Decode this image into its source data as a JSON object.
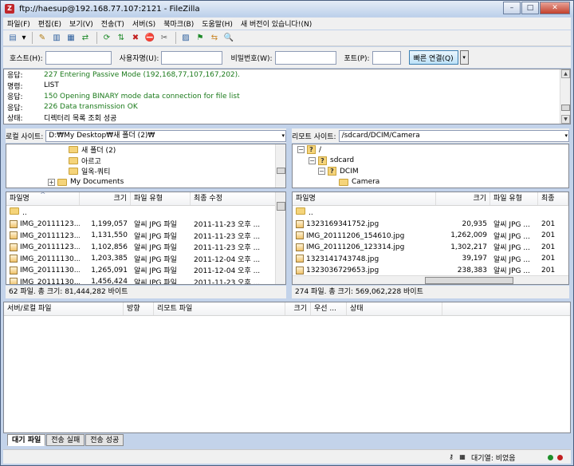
{
  "window": {
    "title": "ftp://haesup@192.168.77.107:2121 - FileZilla",
    "app_icon": "Z",
    "minimize": "–",
    "maximize": "□",
    "close": "✕"
  },
  "menu": [
    "파일(F)",
    "편집(E)",
    "보기(V)",
    "전송(T)",
    "서버(S)",
    "북마크(B)",
    "도움말(H)",
    "새 버전이 있습니다!(N)"
  ],
  "toolbar": {
    "icons": [
      "site-manager-icon",
      "toggle-log-icon",
      "toggle-local-tree-icon",
      "toggle-remote-tree-icon",
      "toggle-queue-icon",
      "refresh-icon",
      "process-queue-icon",
      "cancel-icon",
      "disconnect-icon",
      "reconnect-icon",
      "filter-icon",
      "compare-icon",
      "sync-browse-icon",
      "search-icon"
    ],
    "glyphs": [
      "▤",
      "▾",
      "✎",
      "▥",
      "▦",
      "⇄",
      "⟳",
      "⇅",
      "✖",
      "⛔",
      "✂",
      "▨",
      "⚑",
      "⇆",
      "🔍"
    ]
  },
  "quickconnect": {
    "host_label": "호스트(H):",
    "host_value": "",
    "user_label": "사용자명(U):",
    "user_value": "",
    "pass_label": "비밀번호(W):",
    "pass_value": "",
    "port_label": "포트(P):",
    "port_value": "",
    "button": "빠른 연결(Q)",
    "dropdown": "▾"
  },
  "log": [
    {
      "kind": "응답:",
      "msg": "227 Entering Passive Mode (192,168,77,107,167,202).",
      "green": true
    },
    {
      "kind": "명령:",
      "msg": "LIST",
      "green": false
    },
    {
      "kind": "응답:",
      "msg": "150 Opening BINARY mode data connection for file list",
      "green": true
    },
    {
      "kind": "응답:",
      "msg": "226 Data transmission OK",
      "green": true
    },
    {
      "kind": "상태:",
      "msg": "디렉터리 목록 조회 성공",
      "green": false
    }
  ],
  "scroll": {
    "up": "▲",
    "down": "▼",
    "left": "◀",
    "right": "▶"
  },
  "local": {
    "site_label": "로컬 사이트:",
    "path": "D:₩My Desktop₩새 폴더 (2)₩",
    "path_dropdown": "▾",
    "tree": [
      {
        "name": "새 폴더 (2)",
        "indent": 78,
        "expander": ""
      },
      {
        "name": "아르고",
        "indent": 78,
        "expander": ""
      },
      {
        "name": "일옥-쿼티",
        "indent": 78,
        "expander": ""
      },
      {
        "name": "My Documents",
        "indent": 52,
        "expander": "+"
      }
    ],
    "headers": [
      "파일명",
      "크기",
      "파일 유형",
      "최종 수정"
    ],
    "sort_glyph": "^",
    "files": [
      {
        "name": "..",
        "size": "",
        "type": "",
        "modified": ""
      },
      {
        "name": "IMG_20111123...",
        "size": "1,199,057",
        "type": "알씨 JPG 파일",
        "modified": "2011-11-23 오후 ..."
      },
      {
        "name": "IMG_20111123...",
        "size": "1,131,550",
        "type": "알씨 JPG 파일",
        "modified": "2011-11-23 오후 ..."
      },
      {
        "name": "IMG_20111123...",
        "size": "1,102,856",
        "type": "알씨 JPG 파일",
        "modified": "2011-11-23 오후 ..."
      },
      {
        "name": "IMG_20111130...",
        "size": "1,203,385",
        "type": "알씨 JPG 파일",
        "modified": "2011-12-04 오후 ..."
      },
      {
        "name": "IMG_20111130...",
        "size": "1,265,091",
        "type": "알씨 JPG 파일",
        "modified": "2011-12-04 오후 ..."
      },
      {
        "name": "IMG_20111130...",
        "size": "1,456,424",
        "type": "알씨 JPG 파일",
        "modified": "2011-11-23 오후 ..."
      }
    ],
    "status": "62 파일. 총 크기: 81,444,282 바이트"
  },
  "remote": {
    "site_label": "리모트 사이트:",
    "path": "/sdcard/DCIM/Camera",
    "path_dropdown": "▾",
    "tree": [
      {
        "name": "/",
        "indent": 6,
        "expander": "−",
        "icon": "q"
      },
      {
        "name": "sdcard",
        "indent": 20,
        "expander": "−",
        "icon": "q"
      },
      {
        "name": "DCIM",
        "indent": 32,
        "expander": "−",
        "icon": "q"
      },
      {
        "name": "Camera",
        "indent": 58,
        "expander": "",
        "icon": "folder"
      }
    ],
    "headers": [
      "파일명",
      "크기",
      "파일 유형",
      "최종"
    ],
    "files": [
      {
        "name": "..",
        "size": "",
        "type": "",
        "modified": ""
      },
      {
        "name": "1323169341752.jpg",
        "size": "20,935",
        "type": "알씨 JPG ...",
        "modified": "201"
      },
      {
        "name": "IMG_20111206_154610.jpg",
        "size": "1,262,009",
        "type": "알씨 JPG ...",
        "modified": "201"
      },
      {
        "name": "IMG_20111206_123314.jpg",
        "size": "1,302,217",
        "type": "알씨 JPG ...",
        "modified": "201"
      },
      {
        "name": "1323141743748.jpg",
        "size": "39,197",
        "type": "알씨 JPG ...",
        "modified": "201"
      },
      {
        "name": "1323036729653.jpg",
        "size": "238,383",
        "type": "알씨 JPG ...",
        "modified": "201"
      }
    ],
    "status": "274 파일. 총 크기: 569,062,228 바이트"
  },
  "queue": {
    "headers": [
      "서버/로컬 파일",
      "방향",
      "리모트 파일",
      "크기",
      "우선 ...",
      "상태"
    ],
    "tabs": [
      "대기 파일",
      "전송 실패",
      "전송 성공"
    ]
  },
  "statusbar": {
    "queue_text": "대기열: 비었음",
    "lock_glyph": "⚷",
    "speed_glyph": "▦",
    "dot_colors": [
      "#1e8f2a",
      "#c21f1f"
    ]
  },
  "scroll_fractions": {
    "log": {
      "offset": 0.72,
      "size": 0.18
    },
    "local_tree": {
      "offset": 0.55,
      "size": 0.18
    },
    "local_list": {
      "offset": 0.0,
      "size": 0.12
    },
    "remote_list": {
      "offset": 0.0,
      "size": 0.06
    },
    "remote_hscroll": {
      "offset": 0.48,
      "size": 0.32
    }
  }
}
